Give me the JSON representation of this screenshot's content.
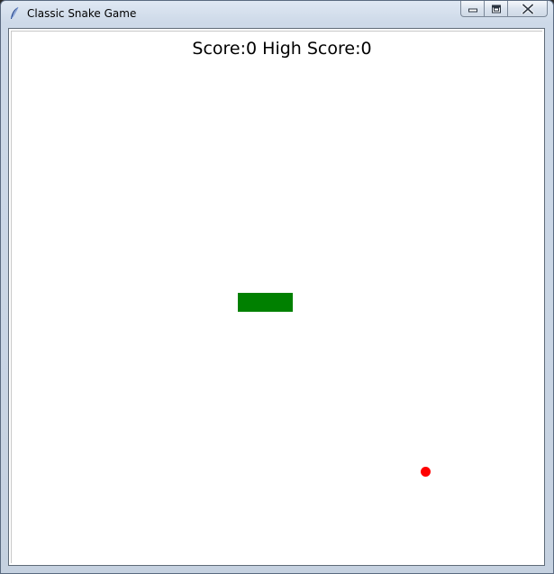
{
  "window": {
    "title": "Classic Snake Game",
    "icon": "feather-icon",
    "controls": [
      "minimize-icon",
      "maximize-icon",
      "close-icon"
    ]
  },
  "game": {
    "score_text": "Score:0 High Score:0",
    "score": 0,
    "high_score": 0,
    "snake_color": "#008000",
    "food_color": "#ff0000",
    "background_color": "#ffffff"
  }
}
